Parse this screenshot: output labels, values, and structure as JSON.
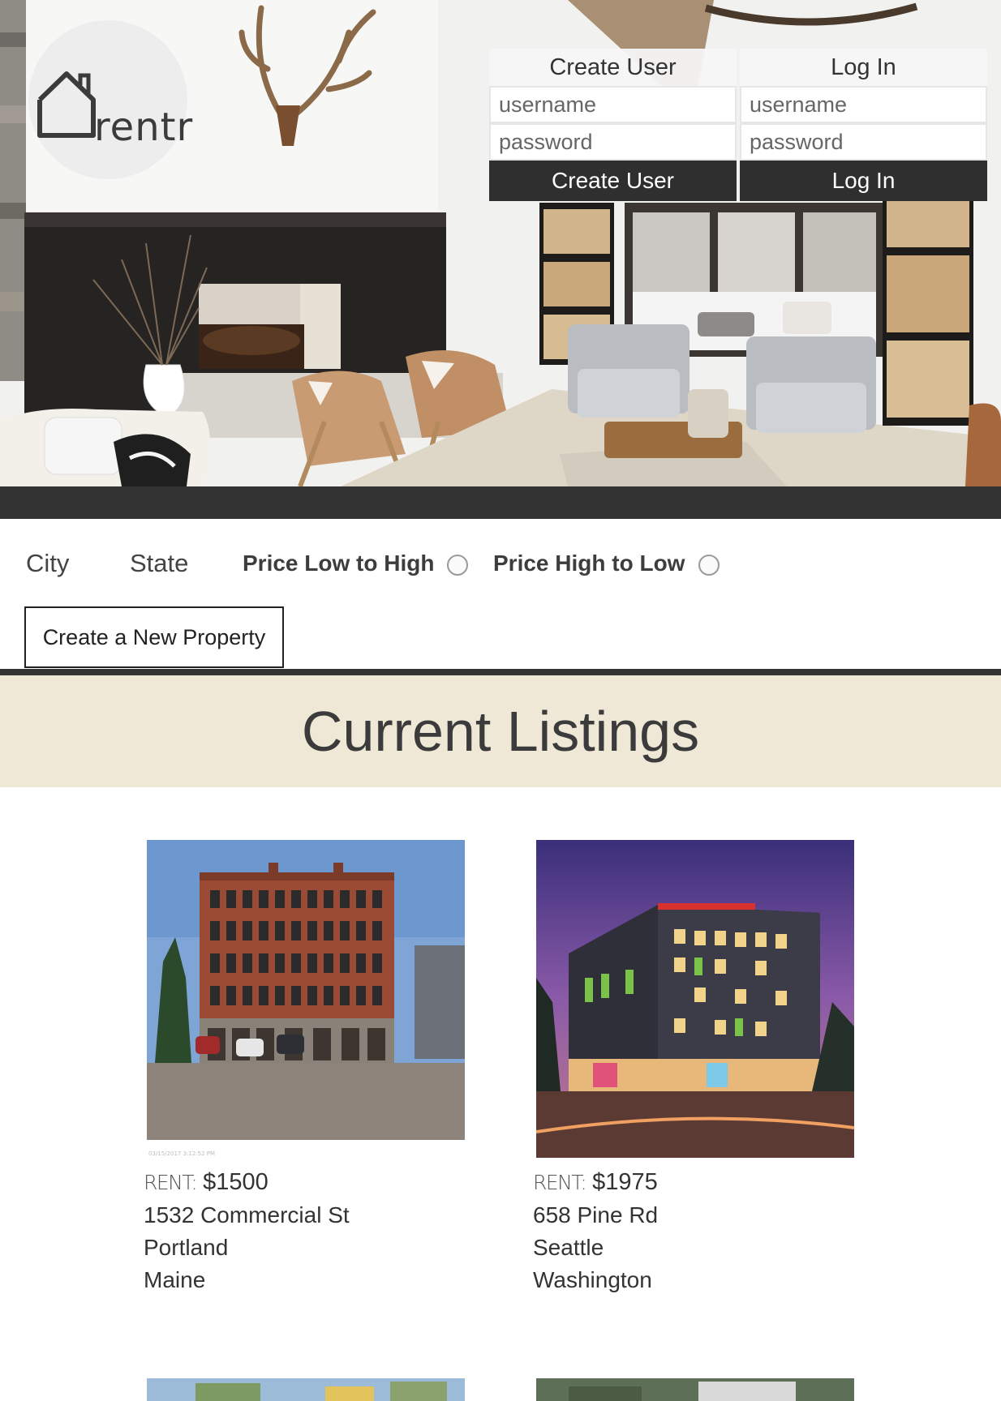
{
  "logo": {
    "text": "rentr"
  },
  "auth": {
    "create": {
      "title": "Create User",
      "username_placeholder": "username",
      "password_placeholder": "password",
      "button": "Create User"
    },
    "login": {
      "title": "Log In",
      "username_placeholder": "username",
      "password_placeholder": "password",
      "button": "Log In"
    }
  },
  "filters": {
    "city": "City",
    "state": "State",
    "sort_low_high": "Price Low to High",
    "sort_high_low": "Price High to Low",
    "new_property_button": "Create a New Property"
  },
  "listings": {
    "title": "Current Listings",
    "items": [
      {
        "rent_label": "RENT:",
        "price": "$1500",
        "address": "1532 Commercial St",
        "city": "Portland",
        "state": "Maine",
        "photo_stamp": "03/15/2017 3:12:52 PM"
      },
      {
        "rent_label": "RENT:",
        "price": "$1975",
        "address": "658 Pine Rd",
        "city": "Seattle",
        "state": "Washington"
      }
    ]
  },
  "colors": {
    "dark": "#333333",
    "banner": "#efe8d6",
    "button": "#2f2f2f"
  }
}
